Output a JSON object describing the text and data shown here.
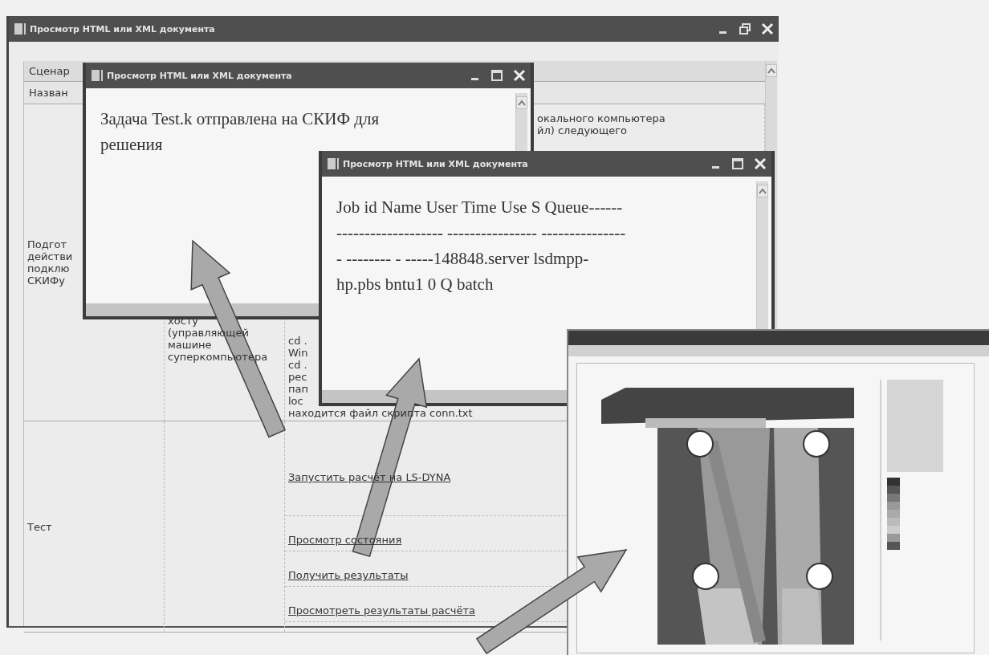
{
  "main_window": {
    "title": "Просмотр HTML или XML документа",
    "table": {
      "scenario_header": "Сценар",
      "name_header": "Назван",
      "prep_row": {
        "column_1": [
          "Подгот",
          "действи",
          "подклю",
          "СКИФу"
        ],
        "column_2": [
          "хосту",
          "(управляющей",
          "машине",
          "суперкомпьютера"
        ],
        "column_3_top": [
          "окального компьютера",
          "йл) следующего"
        ],
        "column_3": [
          "cd .",
          "Win",
          "cd .",
          "рес",
          "пап",
          "loc",
          "находится файл скрипта conn.txt"
        ]
      },
      "test_row": {
        "column_1": "Тест",
        "links": [
          "Запустить расчёт на LS-DYNA",
          "Просмотр состояния",
          "Получить результаты",
          "Просмотреть результаты расчёта"
        ]
      }
    }
  },
  "popup_windows": [
    {
      "title": "Просмотр HTML или XML документа",
      "lines": [
        "Задача Test.k отправлена на СКИФ для",
        "решения"
      ]
    },
    {
      "title": "Просмотр HTML или XML документа",
      "lines": [
        "Job id Name User Time Use S Queue------",
        "------------------- ---------------- ---------------",
        "- -------- - -----148848.server lsdmpp-",
        "hp.pbs bntu1  0 Q batch"
      ]
    }
  ]
}
